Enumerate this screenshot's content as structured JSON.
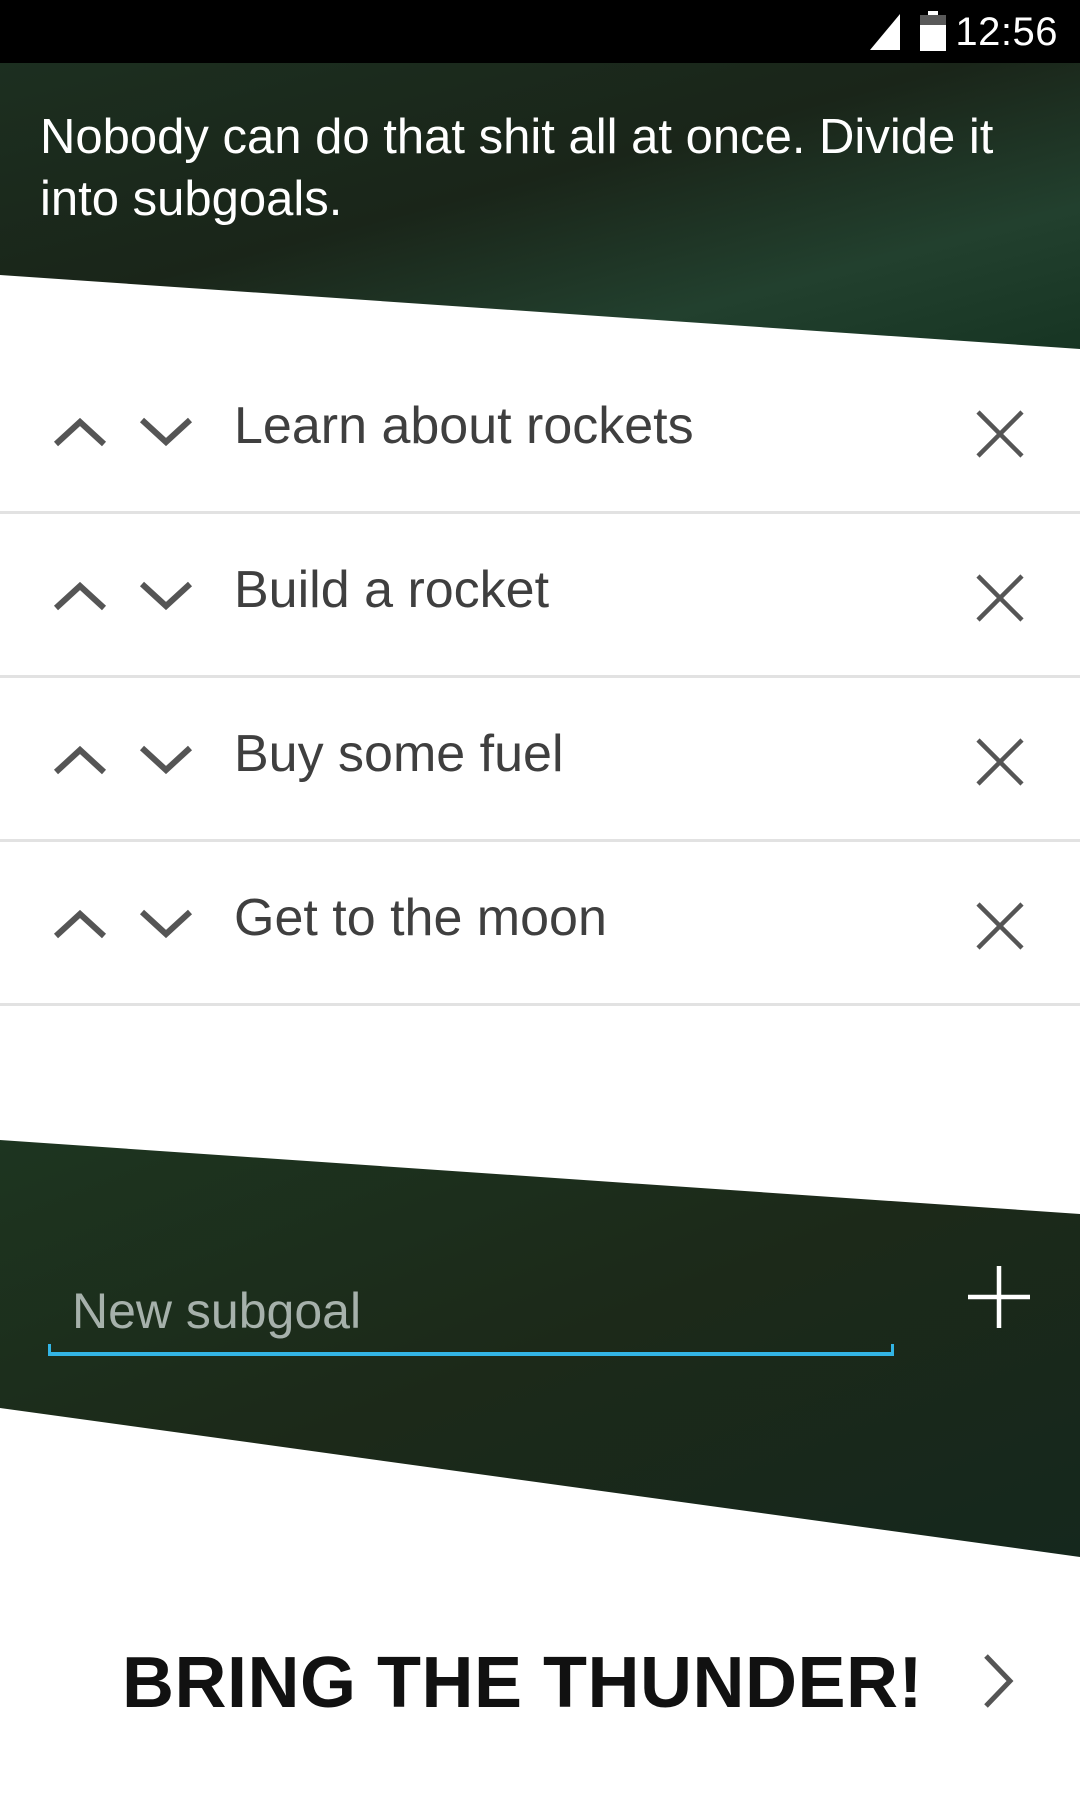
{
  "status_bar": {
    "time": "12:56"
  },
  "header": {
    "message": "Nobody can do that shit all at once. Divide it into subgoals."
  },
  "subgoals": [
    {
      "label": "Learn about rockets"
    },
    {
      "label": "Build a rocket"
    },
    {
      "label": "Buy some fuel"
    },
    {
      "label": "Get to the moon"
    }
  ],
  "new_subgoal": {
    "placeholder": "New subgoal",
    "value": ""
  },
  "action": {
    "label": "BRING THE THUNDER!"
  },
  "colors": {
    "green_dark": "#1b2a1c",
    "green_mid": "#24412d",
    "accent_underline": "#33b5e5",
    "text_dark": "#3f3f3f",
    "divider": "#e2e2e2"
  },
  "icons": {
    "move_up": "chevron-up-icon",
    "move_down": "chevron-down-icon",
    "remove": "close-icon",
    "add": "plus-icon",
    "continue": "chevron-right-icon"
  }
}
